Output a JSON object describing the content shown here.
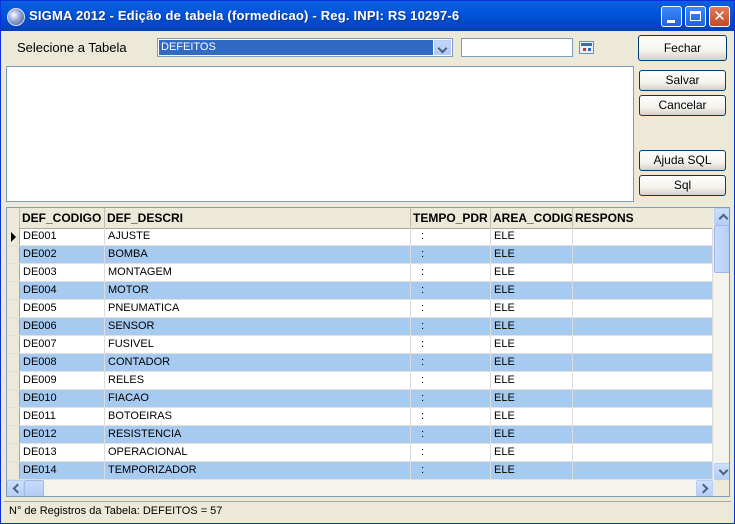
{
  "window": {
    "title": "SIGMA 2012 - Edição de tabela  (formedicao)  - Reg. INPI: RS 10297-6",
    "controls": [
      "minimize-icon",
      "maximize-icon",
      "close-icon"
    ]
  },
  "toolbar": {
    "select_label": "Selecione a Tabela",
    "table_selected": "DEFEITOS",
    "search_value": "",
    "fechar_label": "Fechar"
  },
  "side_buttons": {
    "salvar": "Salvar",
    "cancelar": "Cancelar",
    "ajuda_sql": "Ajuda SQL",
    "sql": "Sql"
  },
  "sql_editor": {
    "value": ""
  },
  "grid": {
    "columns": [
      "DEF_CODIGO",
      "DEF_DESCRI",
      "TEMPO_PDR",
      "AREA_CODIG",
      "RESPONS"
    ],
    "rows": [
      [
        "DE001",
        "AJUSTE",
        ":",
        "ELE",
        ""
      ],
      [
        "DE002",
        "BOMBA",
        ":",
        "ELE",
        ""
      ],
      [
        "DE003",
        "MONTAGEM",
        ":",
        "ELE",
        ""
      ],
      [
        "DE004",
        "MOTOR",
        ":",
        "ELE",
        ""
      ],
      [
        "DE005",
        "PNEUMATICA",
        ":",
        "ELE",
        ""
      ],
      [
        "DE006",
        "SENSOR",
        ":",
        "ELE",
        ""
      ],
      [
        "DE007",
        "FUSIVEL",
        ":",
        "ELE",
        ""
      ],
      [
        "DE008",
        "CONTADOR",
        ":",
        "ELE",
        ""
      ],
      [
        "DE009",
        "RELES",
        ":",
        "ELE",
        ""
      ],
      [
        "DE010",
        "FIACAO",
        ":",
        "ELE",
        ""
      ],
      [
        "DE011",
        "BOTOEIRAS",
        ":",
        "ELE",
        ""
      ],
      [
        "DE012",
        "RESISTENCIA",
        ":",
        "ELE",
        ""
      ],
      [
        "DE013",
        "OPERACIONAL",
        ":",
        "ELE",
        ""
      ],
      [
        "DE014",
        "TEMPORIZADOR",
        ":",
        "ELE",
        ""
      ]
    ],
    "current_row": 0,
    "alt_row_color": "#a6caf0"
  },
  "status": {
    "text": "N° de Registros da Tabela: DEFEITOS = 57"
  },
  "colors": {
    "title_bar": "#0255dc",
    "selection": "#316ac5",
    "window_bg": "#ece9d8"
  }
}
